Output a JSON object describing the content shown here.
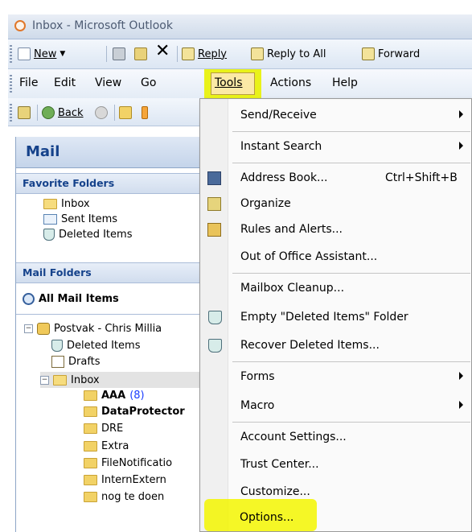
{
  "window": {
    "title": "Inbox - Microsoft Outlook"
  },
  "toolbar": {
    "new_label": "New",
    "reply_label": "Reply",
    "reply_all_label": "Reply to All",
    "forward_label": "Forward"
  },
  "menubar": {
    "file": "File",
    "edit": "Edit",
    "view": "View",
    "go": "Go",
    "tools": "Tools",
    "actions": "Actions",
    "help": "Help"
  },
  "toolbar2": {
    "back_label": "Back"
  },
  "nav": {
    "title": "Mail",
    "favorites_header": "Favorite Folders",
    "favorites": [
      "Inbox",
      "Sent Items",
      "Deleted Items"
    ],
    "mail_folders_header": "Mail Folders",
    "all_mail": "All Mail Items",
    "mailbox": "Postvak - Chris Millia",
    "deleted": "Deleted Items",
    "drafts": "Drafts",
    "inbox": "Inbox",
    "subfolders": [
      {
        "name": "AAA",
        "count": "(8)",
        "bold": true
      },
      {
        "name": "DataProtector",
        "count": "",
        "bold": true
      },
      {
        "name": "DRE",
        "count": "",
        "bold": false
      },
      {
        "name": "Extra",
        "count": "",
        "bold": false
      },
      {
        "name": "FileNotificatio",
        "count": "",
        "bold": false
      },
      {
        "name": "InternExtern",
        "count": "",
        "bold": false
      },
      {
        "name": "nog te doen",
        "count": "",
        "bold": false
      }
    ]
  },
  "tools_menu": {
    "send_receive": "Send/Receive",
    "instant_search": "Instant Search",
    "address_book": "Address Book...",
    "address_book_shortcut": "Ctrl+Shift+B",
    "organize": "Organize",
    "rules": "Rules and Alerts...",
    "out_of_office": "Out of Office Assistant...",
    "mailbox_cleanup": "Mailbox Cleanup...",
    "empty_deleted": "Empty \"Deleted Items\" Folder",
    "recover_deleted": "Recover Deleted Items...",
    "forms": "Forms",
    "macro": "Macro",
    "account_settings": "Account Settings...",
    "trust_center": "Trust Center...",
    "customize": "Customize...",
    "options": "Options..."
  },
  "colors": {
    "highlight": "#f3f600",
    "nav_title": "#15428b",
    "count": "#1a3cff"
  }
}
